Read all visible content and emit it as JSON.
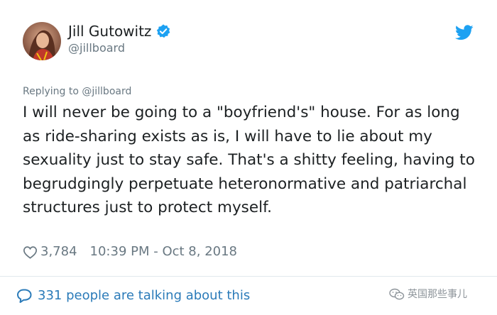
{
  "author": {
    "display_name": "Jill Gutowitz",
    "handle": "@jillboard",
    "verified": true
  },
  "reply_context": "Replying to @jillboard",
  "tweet": {
    "text": "I will never be going to a \"boyfriend's\" house. For as long as ride-sharing exists as is, I will have to lie about my sexuality just to stay safe. That's a shitty feeling, having to begrudgingly perpetuate heteronormative and patriarchal structures just to protect myself."
  },
  "meta": {
    "likes": "3,784",
    "timestamp": "10:39 PM - Oct 8, 2018"
  },
  "conversation": {
    "label": "331 people are talking about this"
  },
  "watermark": {
    "text": "英国那些事儿"
  },
  "icons": {
    "verified": "verified-badge-icon",
    "bird": "twitter-bird-icon",
    "heart": "heart-outline-icon",
    "speech": "speech-bubble-icon",
    "wechat": "wechat-logo-icon"
  },
  "colors": {
    "text": "#1c2022",
    "secondary": "#697882",
    "link": "#2b7bb9",
    "twitter_blue": "#1da1f2"
  }
}
